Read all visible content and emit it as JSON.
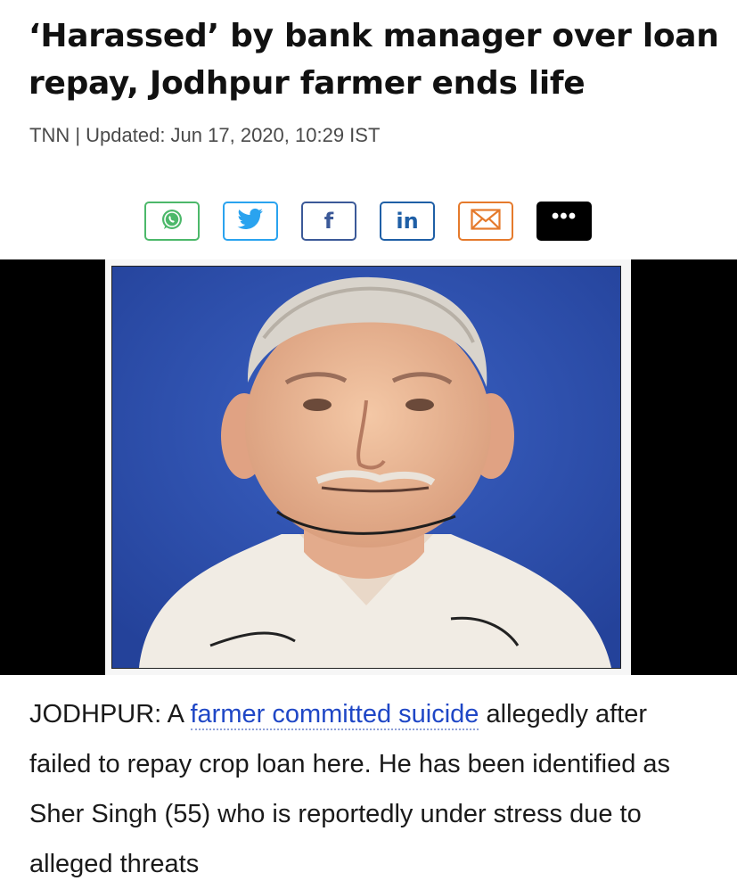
{
  "article": {
    "headline": "‘Harassed’ by bank manager over loan repay, Jodhpur farmer ends life",
    "byline": "TNN | Updated: Jun 17, 2020, 10:29 IST"
  },
  "share": {
    "buttons": [
      {
        "name": "whatsapp",
        "icon": "whatsapp-icon",
        "color": "#4cb86a"
      },
      {
        "name": "twitter",
        "icon": "twitter-icon",
        "color": "#2aa3ef"
      },
      {
        "name": "facebook",
        "icon": "facebook-icon",
        "glyph": "f",
        "color": "#3b5998"
      },
      {
        "name": "linkedin",
        "icon": "linkedin-icon",
        "glyph": "in",
        "color": "#1f5fa6"
      },
      {
        "name": "email",
        "icon": "mail-icon",
        "color": "#e57a2c"
      },
      {
        "name": "more",
        "icon": "more-icon",
        "glyph": "•••",
        "color": "#000000"
      }
    ]
  },
  "body": {
    "lead": "JODHPUR: A ",
    "link_text": "farmer committed suicide",
    "continuation": " allegedly after failed to repay crop loan here. He has been identified as Sher Singh (55) who is reportedly under stress due to alleged threats"
  },
  "colors": {
    "link": "#1f47c6",
    "photo_background": "#2f4fae"
  }
}
